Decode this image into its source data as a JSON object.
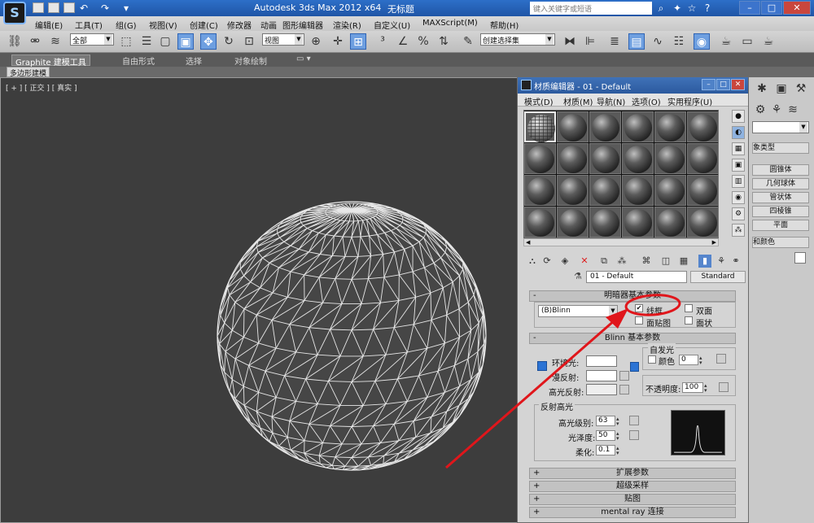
{
  "titlebar": {
    "app_title": "Autodesk 3ds Max  2012 x64",
    "doc_title": "无标题",
    "search_placeholder": "键入关键字或短语"
  },
  "menubar": {
    "items": [
      "编辑(E)",
      "工具(T)",
      "组(G)",
      "视图(V)",
      "创建(C)",
      "修改器",
      "动画",
      "图形编辑器",
      "渲染(R)",
      "自定义(U)",
      "MAXScript(M)",
      "帮助(H)"
    ]
  },
  "toolbar": {
    "selection_filter": "全部",
    "ref_coord": "视图",
    "named_selection": "创建选择集"
  },
  "ribbon": {
    "tabs": [
      "Graphite 建模工具",
      "自由形式",
      "选择",
      "对象绘制"
    ],
    "subtab": "多边形建模"
  },
  "viewport": {
    "label": "[ + ] [ 正交 ] [ 真实 ]"
  },
  "command_panel": {
    "items": [
      "圆锥体",
      "几何球体",
      "管状体",
      "四棱锥",
      "平面"
    ],
    "section_type": "象类型",
    "section_color": "和颜色"
  },
  "material_editor": {
    "title": "材质编辑器 - 01 - Default",
    "menu": [
      "模式(D)",
      "材质(M)",
      "导航(N)",
      "选项(O)",
      "实用程序(U)"
    ],
    "material_name": "01 - Default",
    "material_type": "Standard",
    "shader_rollout": {
      "title": "明暗器基本参数",
      "shader": "(B)Blinn",
      "wire": "线框",
      "two_sided": "双面",
      "face_map": "面贴图",
      "faceted": "面状",
      "wire_checked": true
    },
    "blinn_rollout": {
      "title": "Blinn 基本参数",
      "self_illum_group": "自发光",
      "color_label": "颜色",
      "self_illum_value": "0",
      "ambient": "环境光:",
      "diffuse": "漫反射:",
      "specular": "高光反射:",
      "opacity_label": "不透明度:",
      "opacity_value": "100",
      "spec_group": "反射高光",
      "spec_level_label": "高光级别:",
      "spec_level": "63",
      "gloss_label": "光泽度:",
      "gloss": "50",
      "soften_label": "柔化:",
      "soften": "0.1"
    },
    "collapsed_rollouts": [
      "扩展参数",
      "超级采样",
      "贴图",
      "mental ray 连接"
    ]
  },
  "colors": {
    "title_blue": "#2d6fc8",
    "viewport_bg": "#3d3d3d",
    "annotation_red": "#e0161b",
    "wire_color": "#e8e8e8"
  }
}
